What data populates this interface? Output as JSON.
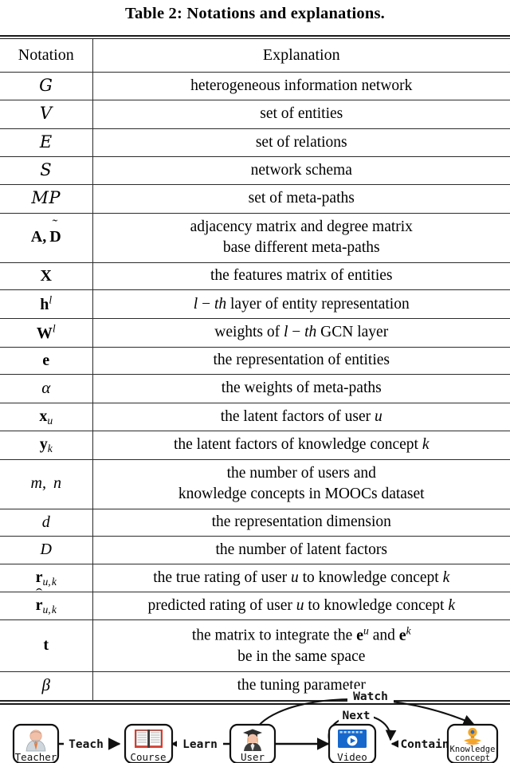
{
  "caption": "Table 2: Notations and explanations.",
  "table": {
    "headers": [
      "Notation",
      "Explanation"
    ],
    "rows": [
      {
        "notation": "G",
        "notation_style": "calligraphic",
        "explanation": [
          "heterogeneous information network"
        ]
      },
      {
        "notation": "V",
        "notation_style": "calligraphic",
        "explanation": [
          "set of entities"
        ]
      },
      {
        "notation": "E",
        "notation_style": "calligraphic",
        "explanation": [
          "set of relations"
        ]
      },
      {
        "notation": "S",
        "notation_style": "calligraphic",
        "explanation": [
          "network schema"
        ]
      },
      {
        "notation": "MP",
        "notation_style": "calligraphic",
        "explanation": [
          "set of meta-paths"
        ]
      },
      {
        "notation": "A, D~",
        "notation_style": "bold-tilde",
        "explanation": [
          "adjacency matrix and degree matrix",
          "base different meta-paths"
        ]
      },
      {
        "notation": "X",
        "notation_style": "bold",
        "explanation": [
          "the features matrix of entities"
        ]
      },
      {
        "notation": "h^l",
        "notation_style": "bold-sup",
        "explanation": [
          "l − th layer of entity representation"
        ]
      },
      {
        "notation": "W^l",
        "notation_style": "bold-sup",
        "explanation": [
          "weights of l − th GCN layer"
        ]
      },
      {
        "notation": "e",
        "notation_style": "bold",
        "explanation": [
          "the representation of entities"
        ]
      },
      {
        "notation": "α",
        "notation_style": "greek",
        "explanation": [
          "the weights of meta-paths"
        ]
      },
      {
        "notation": "x_u",
        "notation_style": "bold-sub",
        "explanation": [
          "the latent factors of user u"
        ]
      },
      {
        "notation": "y_k",
        "notation_style": "bold-sub",
        "explanation": [
          "the latent factors of knowledge concept k"
        ]
      },
      {
        "notation": "m, n",
        "notation_style": "italic",
        "explanation": [
          "the number of users and",
          "knowledge concepts in MOOCs dataset"
        ]
      },
      {
        "notation": "d",
        "notation_style": "italic",
        "explanation": [
          "the representation dimension"
        ]
      },
      {
        "notation": "D",
        "notation_style": "italic",
        "explanation": [
          "the number of latent factors"
        ]
      },
      {
        "notation": "r_u,k",
        "notation_style": "bold-sub",
        "explanation": [
          "the true rating of user u to knowledge concept k"
        ]
      },
      {
        "notation": "r^_u,k",
        "notation_style": "bold-hat-sub",
        "explanation": [
          "predicted rating of user u to knowledge concept k"
        ]
      },
      {
        "notation": "t",
        "notation_style": "bold",
        "explanation": [
          "the matrix to integrate the e^u and e^k",
          "be in the same space"
        ]
      },
      {
        "notation": "β",
        "notation_style": "greek",
        "explanation": [
          "the tuning parameter"
        ]
      }
    ]
  },
  "diagram": {
    "nodes": [
      {
        "id": "teacher",
        "label": "Teacher",
        "icon": "teacher-avatar-icon"
      },
      {
        "id": "course",
        "label": "Course",
        "icon": "open-book-icon"
      },
      {
        "id": "user",
        "label": "User",
        "icon": "graduate-avatar-icon"
      },
      {
        "id": "video",
        "label": "Video",
        "icon": "video-player-icon"
      },
      {
        "id": "knowledge",
        "label": "Knowledge\nconcept",
        "icon": "lightbulb-idea-icon"
      }
    ],
    "edges": [
      {
        "from": "teacher",
        "to": "course",
        "label": "Teach"
      },
      {
        "from": "user",
        "to": "course",
        "label": "Learn"
      },
      {
        "from": "user",
        "to": "video",
        "label": ""
      },
      {
        "from": "user",
        "to": "knowledge",
        "label": "Watch"
      },
      {
        "from": "video",
        "to": "video",
        "label": "Next"
      },
      {
        "from": "knowledge",
        "to": "video",
        "label": "Contain"
      }
    ],
    "colors": {
      "node_border": "#1a1a1a",
      "node_fill": "#ffffff",
      "book_red": "#e8392a",
      "video_blue": "#1668cc",
      "bulb_orange": "#f5a623",
      "skin": "#f2c0a8",
      "tie_blue": "#4a7fb5",
      "hair_dark": "#3a3a3a"
    }
  }
}
